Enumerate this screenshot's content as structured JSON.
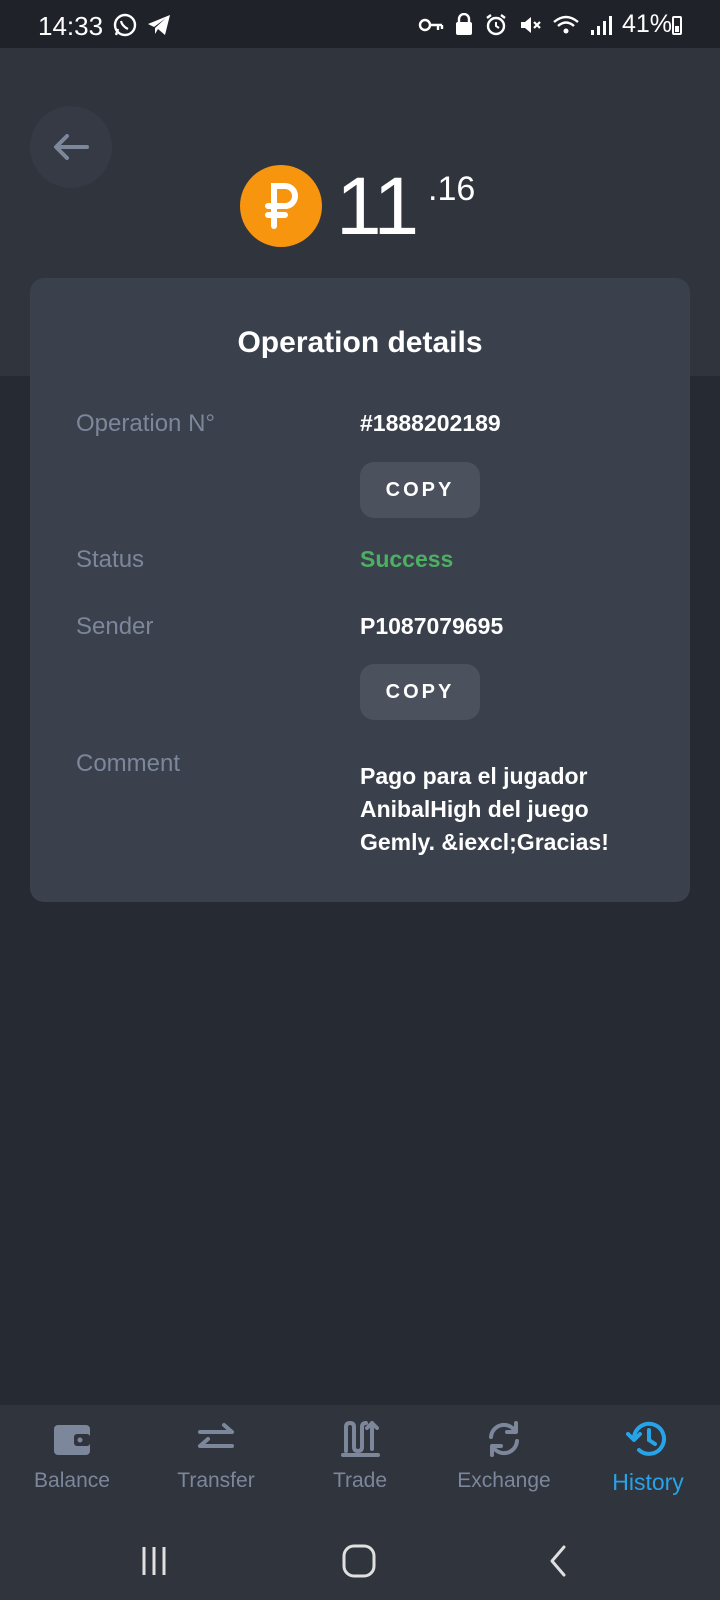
{
  "status_bar": {
    "time": "14:33",
    "battery": "41%",
    "icons": [
      "whatsapp-icon",
      "telegram-icon",
      "key-icon",
      "lock-icon",
      "alarm-icon",
      "mute-icon",
      "wifi-icon",
      "signal-icon",
      "battery-icon"
    ]
  },
  "header": {
    "amount_integer": "11",
    "amount_decimal": ".16",
    "currency_icon": "ruble-coin-icon",
    "coin_color": "#f7950f"
  },
  "card": {
    "title": "Operation details",
    "operation_label": "Operation N°",
    "operation_value": "#1888202189",
    "copy_label": "COPY",
    "status_label": "Status",
    "status_value": "Success",
    "status_color": "#4caf62",
    "sender_label": "Sender",
    "sender_value": "P1087079695",
    "comment_label": "Comment",
    "comment_value": "Pago para el jugador AnibalHigh del juego Gemly. &iexcl;Gracias!"
  },
  "bottom_nav": {
    "items": [
      {
        "label": "Balance",
        "icon": "wallet-icon"
      },
      {
        "label": "Transfer",
        "icon": "transfer-icon"
      },
      {
        "label": "Trade",
        "icon": "trade-icon"
      },
      {
        "label": "Exchange",
        "icon": "exchange-icon"
      },
      {
        "label": "History",
        "icon": "history-icon",
        "active": true
      }
    ],
    "active_color": "#27a4e8"
  },
  "system_nav": [
    "recent-apps-icon",
    "home-icon",
    "back-icon"
  ]
}
